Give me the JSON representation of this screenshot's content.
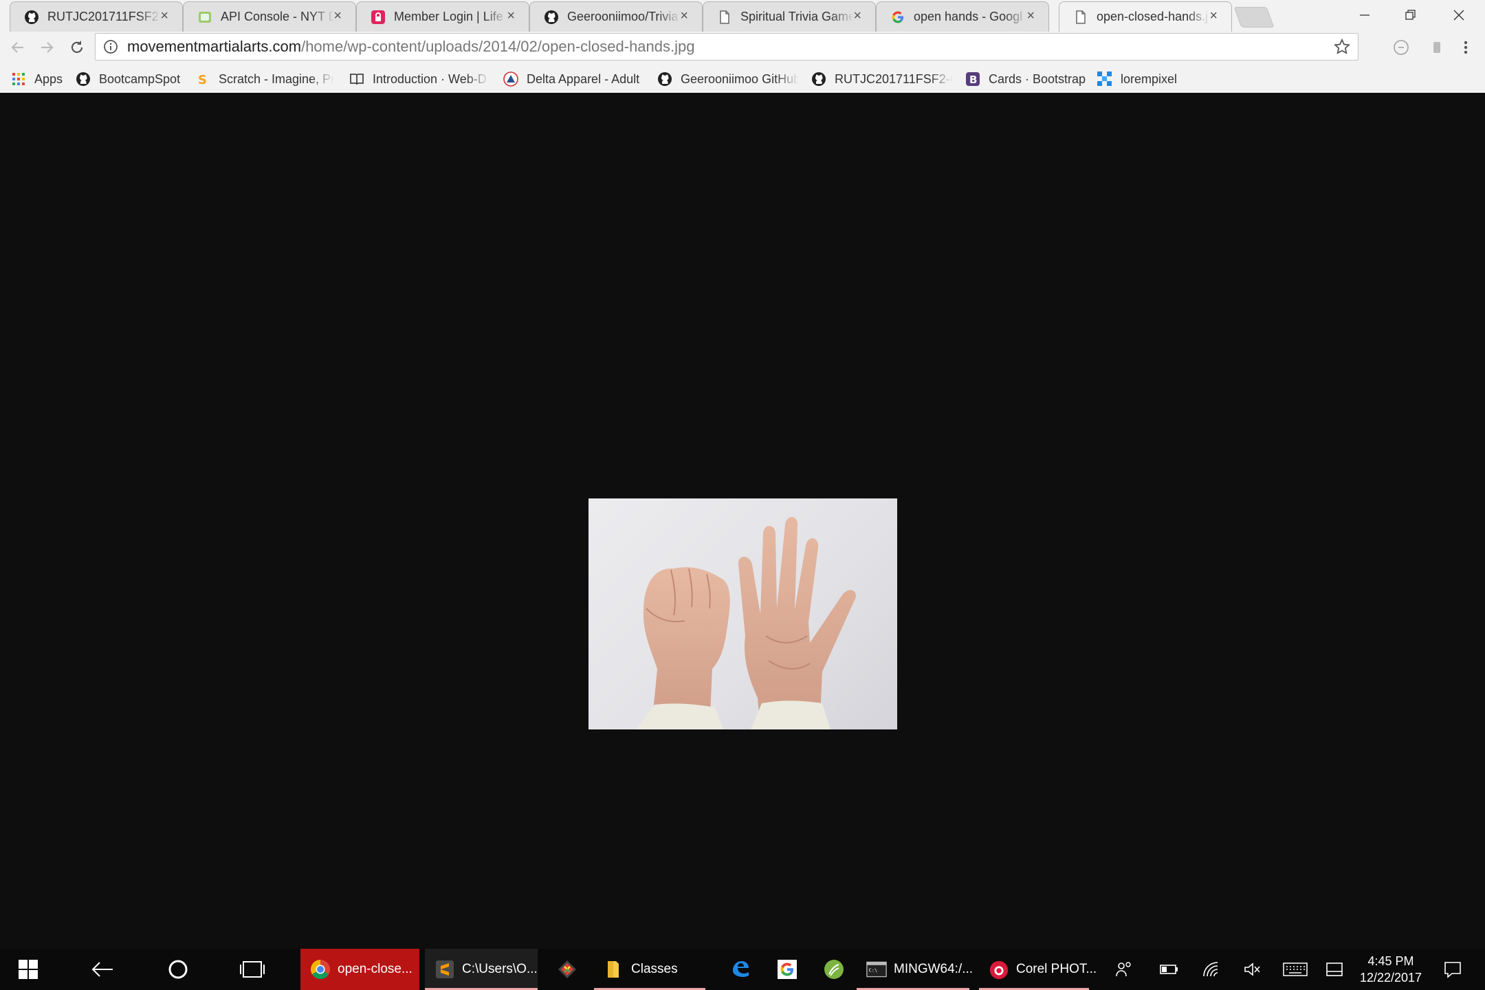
{
  "tabs": [
    {
      "title": "RUTJC201711FSF2-C",
      "icon": "github-icon"
    },
    {
      "title": "API Console - NYT D",
      "icon": "api-console-icon"
    },
    {
      "title": "Member Login | Life",
      "icon": "lock-icon"
    },
    {
      "title": "Geerooniimoo/Trivia",
      "icon": "github-icon"
    },
    {
      "title": "Spiritual Trivia Game",
      "icon": "page-icon"
    },
    {
      "title": "open hands - Googl",
      "icon": "google-icon"
    },
    {
      "title": "open-closed-hands.j",
      "icon": "page-icon"
    }
  ],
  "close_glyph": "×",
  "address_bar": {
    "domain": "movementmartialarts.com",
    "path": "/home/wp-content/uploads/2014/02/open-closed-hands.jpg"
  },
  "bookmarks": [
    {
      "label": "Apps",
      "icon": "apps-grid-icon"
    },
    {
      "label": "BootcampSpot",
      "icon": "github-icon"
    },
    {
      "label": "Scratch - Imagine, Pro",
      "icon": "scratch-icon"
    },
    {
      "label": "Introduction · Web-D",
      "icon": "book-icon"
    },
    {
      "label": "Delta Apparel - Adult",
      "icon": "delta-icon"
    },
    {
      "label": "Geerooniimoo GitHub",
      "icon": "github-icon"
    },
    {
      "label": "RUTJC201711FSF2-Cl",
      "icon": "github-icon"
    },
    {
      "label": "Cards · Bootstrap",
      "icon": "bootstrap-icon"
    },
    {
      "label": "lorempixel",
      "icon": "lorempixel-icon"
    }
  ],
  "image": {
    "alt": "open-closed-hands.jpg",
    "subject": "closed fist and open hand"
  },
  "taskbar": {
    "apps": [
      {
        "label": "open-close...",
        "icon": "chrome-icon",
        "active": true
      },
      {
        "label": "C:\\Users\\O...",
        "icon": "sublime-icon"
      },
      {
        "label": "",
        "icon": "git-gui-icon"
      },
      {
        "label": "Classes",
        "icon": "folder-icon"
      },
      {
        "label": "",
        "icon": "edge-icon"
      },
      {
        "label": "",
        "icon": "google-icon"
      },
      {
        "label": "",
        "icon": "green-app-icon"
      },
      {
        "label": "MINGW64:/...",
        "icon": "terminal-icon"
      },
      {
        "label": "Corel PHOT...",
        "icon": "corel-icon"
      }
    ],
    "time": "4:45 PM",
    "date": "12/22/2017"
  },
  "colors": {
    "viewport_bg": "#0e0e0e",
    "taskbar_bg": "#0a0a0a",
    "active_taskbar_app": "#b81414"
  }
}
